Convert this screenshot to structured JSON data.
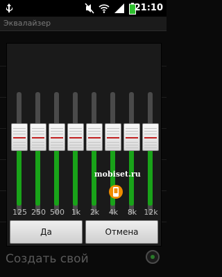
{
  "status_bar": {
    "time": "21:10",
    "icons": [
      "usb-icon",
      "mute-icon",
      "wifi-icon",
      "signal-icon",
      "battery-icon"
    ]
  },
  "title_bar": {
    "title": "Эквалайзер"
  },
  "background": {
    "create_custom": "Создать свой"
  },
  "dialog": {
    "bands": [
      {
        "label": "125",
        "level": 0.5
      },
      {
        "label": "250",
        "level": 0.5
      },
      {
        "label": "500",
        "level": 0.5
      },
      {
        "label": "1k",
        "level": 0.5
      },
      {
        "label": "2k",
        "level": 0.5
      },
      {
        "label": "4k",
        "level": 0.5
      },
      {
        "label": "8k",
        "level": 0.5
      },
      {
        "label": "12k",
        "level": 0.5
      }
    ],
    "ok_label": "Да",
    "cancel_label": "Отмена"
  },
  "watermark": {
    "text": "mobiset.ru",
    "accent": "#f08c00"
  },
  "colors": {
    "slider_fill": "#19a319",
    "slider_marker": "#c21f1f"
  }
}
